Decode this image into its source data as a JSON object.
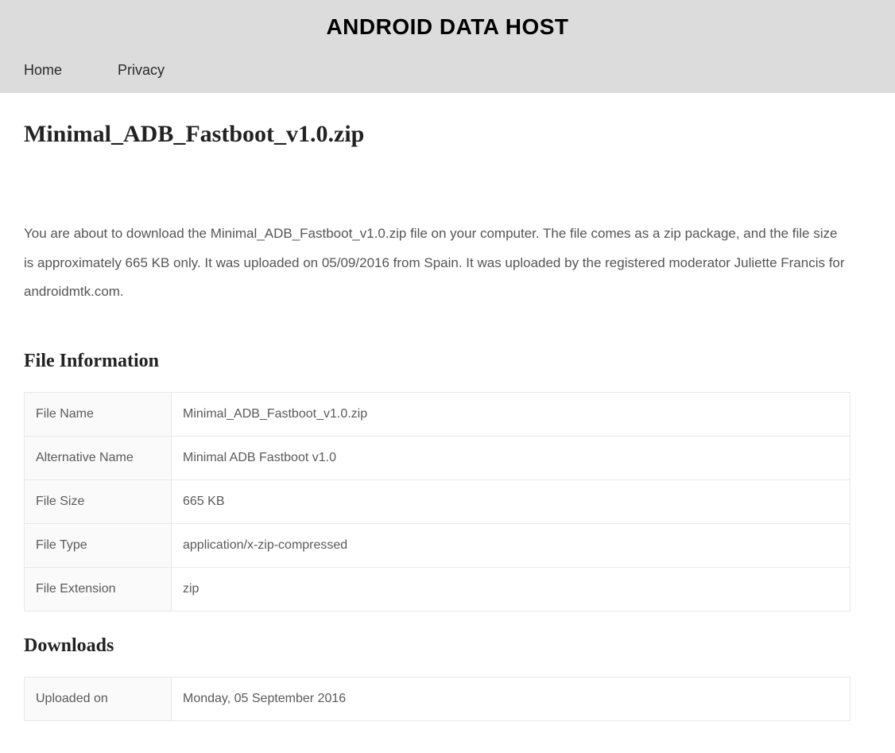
{
  "header": {
    "site_title": "ANDROID DATA HOST",
    "nav": {
      "home": "Home",
      "privacy": "Privacy"
    }
  },
  "page": {
    "title": "Minimal_ADB_Fastboot_v1.0.zip",
    "description": "You are about to download the Minimal_ADB_Fastboot_v1.0.zip file on your computer. The file comes as a zip package, and the file size is approximately 665 KB only. It was uploaded on 05/09/2016 from Spain. It was uploaded by the registered moderator Juliette Francis for androidmtk.com."
  },
  "sections": {
    "file_info_heading": "File Information",
    "downloads_heading": "Downloads"
  },
  "file_info": {
    "rows": [
      {
        "label": "File Name",
        "value": "Minimal_ADB_Fastboot_v1.0.zip"
      },
      {
        "label": "Alternative Name",
        "value": "Minimal ADB Fastboot v1.0"
      },
      {
        "label": "File Size",
        "value": "665 KB"
      },
      {
        "label": "File Type",
        "value": "application/x-zip-compressed"
      },
      {
        "label": "File Extension",
        "value": "zip"
      }
    ]
  },
  "downloads": {
    "rows": [
      {
        "label": "Uploaded on",
        "value": "Monday, 05 September 2016"
      }
    ]
  }
}
